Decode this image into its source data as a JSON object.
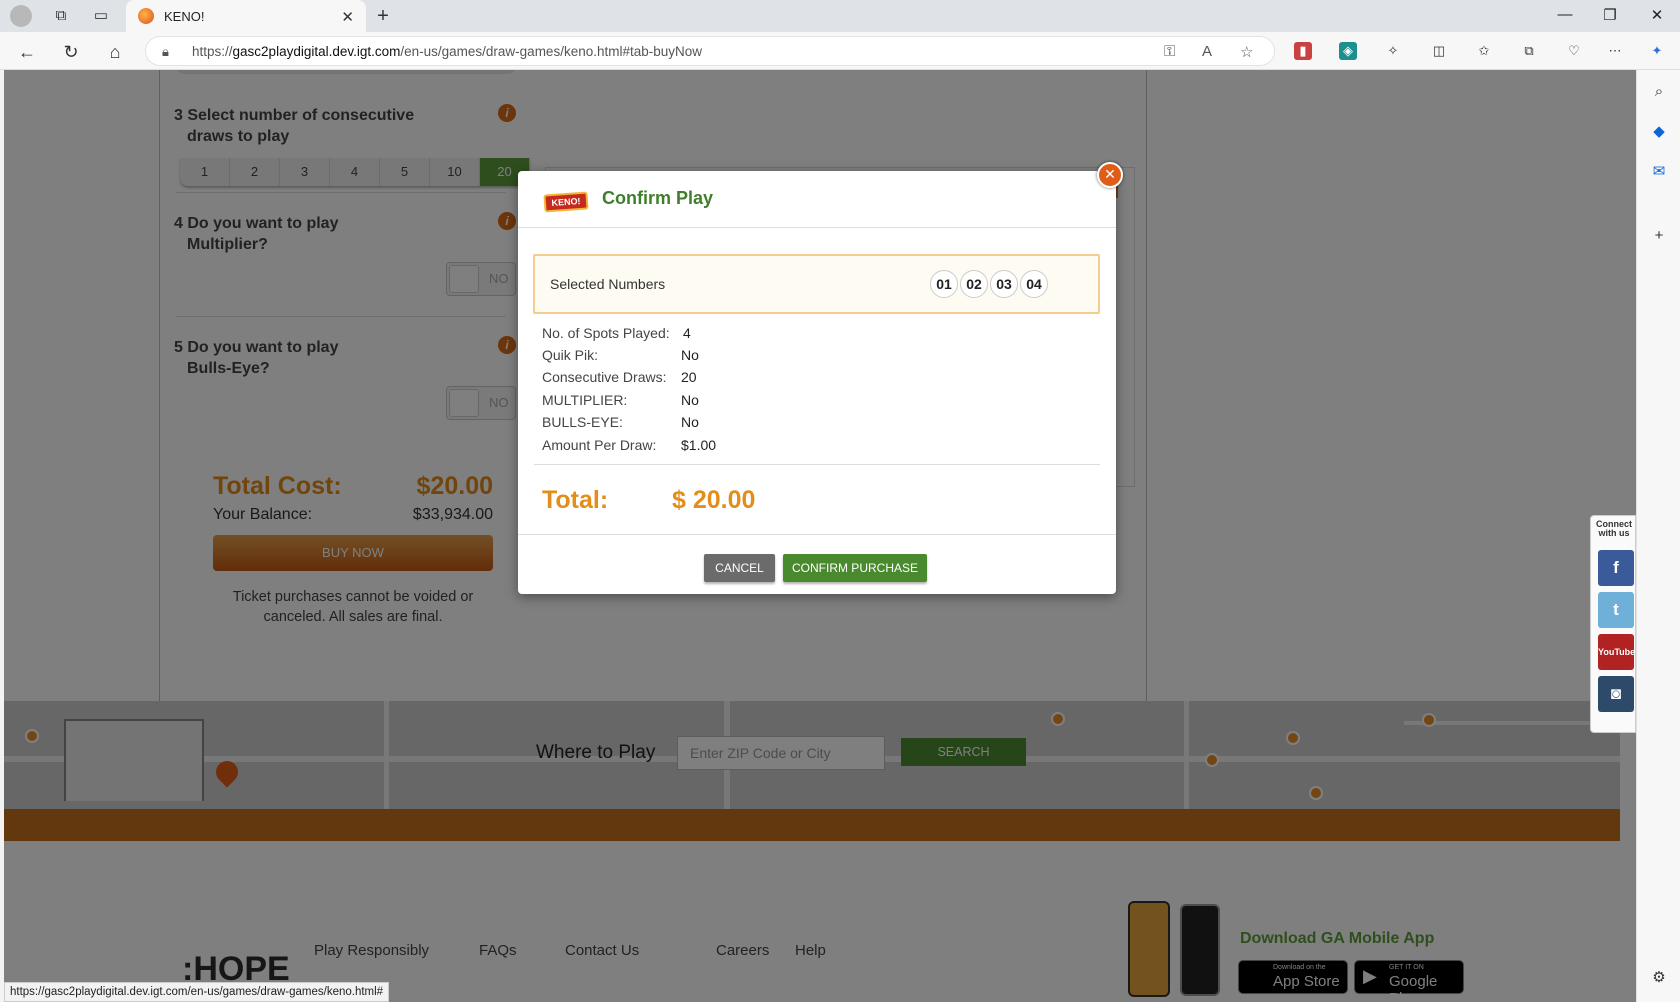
{
  "browser": {
    "tab_title": "KENO!",
    "url_prefix": "https://",
    "url_host": "gasc2playdigital.dev.igt.com",
    "url_path": "/en-us/games/draw-games/keno.html#tab-buyNow",
    "status_url": "https://gasc2playdigital.dev.igt.com/en-us/games/draw-games/keno.html#"
  },
  "steps": {
    "step3": {
      "number": "3",
      "label_line1": "Select number of consecutive",
      "label_line2": "draws to play"
    },
    "step4": {
      "number": "4",
      "label_line1": "Do you want to play",
      "label_line2": "Multiplier?"
    },
    "step5": {
      "number": "5",
      "label_line1": "Do you want to play",
      "label_line2": "Bulls-Eye?"
    },
    "draw_options": [
      "1",
      "2",
      "3",
      "4",
      "5",
      "10",
      "20"
    ],
    "draw_selected": "20",
    "toggle_label": "NO"
  },
  "summary": {
    "total_cost_label": "Total Cost:",
    "total_cost_value": "$20.00",
    "balance_label": "Your Balance:",
    "balance_value": "$33,934.00",
    "buy_now_label": "BUY NOW",
    "disclaimer": "Ticket purchases cannot be voided or canceled. All sales are final."
  },
  "where_to_play": {
    "label": "Where to Play",
    "placeholder": "Enter ZIP Code or City",
    "search_label": "SEARCH"
  },
  "footer": {
    "links": [
      "Play Responsibly",
      "FAQs",
      "Contact Us",
      "Careers",
      "Help"
    ],
    "logo_text": ":HOPE",
    "app_title": "Download GA Mobile App",
    "appstore_small": "Download on the",
    "appstore_big": "App Store",
    "googleplay_small": "GET IT ON",
    "googleplay_big": "Google Play"
  },
  "social": {
    "caption": "Connect with us",
    "facebook": "f",
    "twitter": "t",
    "youtube": "YouTube",
    "instagram": "◙"
  },
  "modal": {
    "logo_text": "KENO!",
    "title": "Confirm Play",
    "selected_label": "Selected Numbers",
    "selected_numbers": [
      "01",
      "02",
      "03",
      "04"
    ],
    "details": [
      {
        "label": "No. of Spots Played:",
        "value": "4"
      },
      {
        "label": "Quik Pik:",
        "value": "No"
      },
      {
        "label": "Consecutive Draws:",
        "value": "20"
      },
      {
        "label": "MULTIPLIER:",
        "value": "No"
      },
      {
        "label": "BULLS-EYE:",
        "value": "No"
      },
      {
        "label": "Amount Per Draw:",
        "value": "$1.00"
      }
    ],
    "total_label": "Total:",
    "total_value": "$ 20.00",
    "cancel_label": "CANCEL",
    "confirm_label": "CONFIRM PURCHASE"
  },
  "colors": {
    "accent_green": "#4a8a2f",
    "accent_orange": "#e38e1a",
    "close_orange": "#e05c17"
  }
}
